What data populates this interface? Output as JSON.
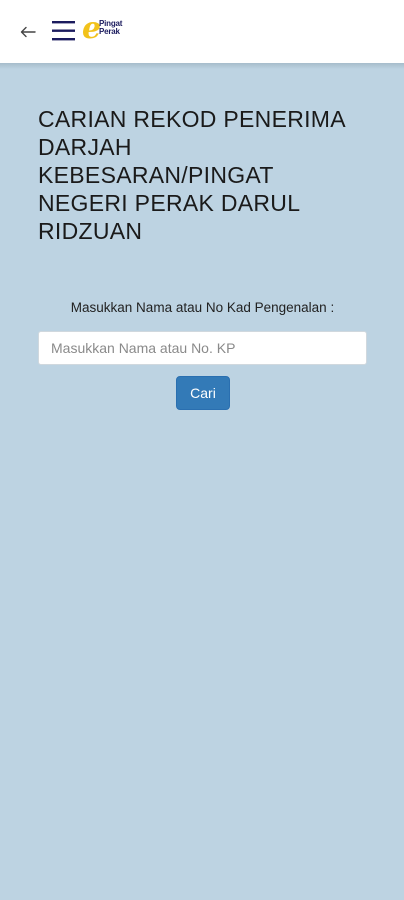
{
  "header": {
    "back_icon": "arrow-left-icon",
    "menu_icon": "hamburger-menu-icon",
    "logo": {
      "letter": "e",
      "line1": "Pingat",
      "line2": "Perak",
      "colors": {
        "letter": "#f2c21b",
        "text": "#1b1b5e"
      }
    }
  },
  "main": {
    "title": "CARIAN REKOD PENERIMA DARJAH KEBESARAN/PINGAT NEGERI PERAK DARUL RIDZUAN",
    "search_label": "Masukkan Nama atau No Kad Pengenalan :",
    "search_value": "",
    "search_placeholder": "Masukkan Nama atau No. KP",
    "search_button": "Cari"
  },
  "colors": {
    "background": "#bdd3e2",
    "header": "#ffffff",
    "button": "#337ab7"
  }
}
